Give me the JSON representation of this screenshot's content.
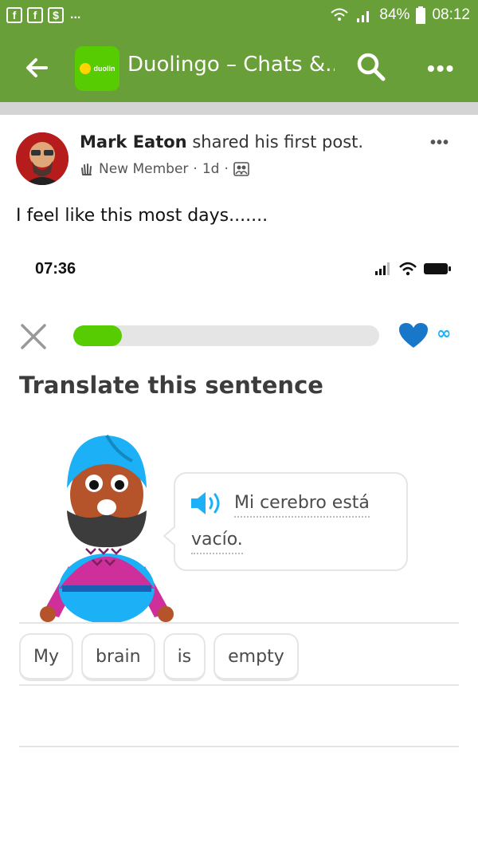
{
  "status_bar": {
    "battery": "84%",
    "time": "08:12",
    "left_icons": [
      "facebook-icon",
      "facebook-icon",
      "shopping-bag-icon"
    ],
    "overflow": "..."
  },
  "app_bar": {
    "title": "Duolingo – Chats &...",
    "group_logo_text": "duolin",
    "accent_color": "#689f38"
  },
  "post": {
    "author": "Mark Eaton",
    "action": "shared his first post.",
    "badge": "New Member",
    "age": "1d",
    "separator": "·",
    "text": "I feel like this most days......."
  },
  "embedded_screenshot": {
    "time": "07:36",
    "progress_fraction": 0.16,
    "hearts": "∞",
    "instruction": "Translate this sentence",
    "prompt_line1": "Mi cerebro está",
    "prompt_line2": "vacío.",
    "word_tiles": [
      "My",
      "brain",
      "is",
      "empty"
    ],
    "colors": {
      "green": "#58cc02",
      "blue": "#1cb0f6",
      "heart": "#1877c9"
    }
  }
}
